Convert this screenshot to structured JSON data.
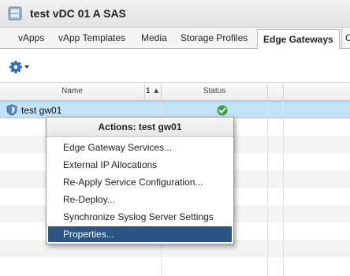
{
  "window": {
    "title": "test vDC 01 A SAS"
  },
  "tabs": [
    {
      "label": "vApps"
    },
    {
      "label": "vApp Templates"
    },
    {
      "label": "Media"
    },
    {
      "label": "Storage Profiles"
    },
    {
      "label": "Edge Gateways",
      "active": true
    },
    {
      "label": "C"
    }
  ],
  "grid": {
    "columns": {
      "name": "Name",
      "sort_indicator": "1 ▲",
      "status": "Status"
    },
    "rows": [
      {
        "name": "test gw01",
        "status": "ok"
      }
    ]
  },
  "context_menu": {
    "title": "Actions: test gw01",
    "items": [
      {
        "label": "Edge Gateway Services..."
      },
      {
        "label": "External IP Allocations"
      },
      {
        "label": "Re-Apply Service Configuration..."
      },
      {
        "label": "Re-Deploy..."
      },
      {
        "label": "Synchronize Syslog Server Settings"
      },
      {
        "label": "Properties...",
        "highlighted": true
      }
    ]
  },
  "colors": {
    "selection_row": "#c3e2f7",
    "menu_highlight": "#2a5585",
    "status_ok": "#3da23d",
    "gear": "#2f6db5"
  },
  "icons": {
    "title": "vdc-icon",
    "toolbar": "gear-icon",
    "row": "edge-gateway-icon",
    "status": "check-circle-icon"
  }
}
